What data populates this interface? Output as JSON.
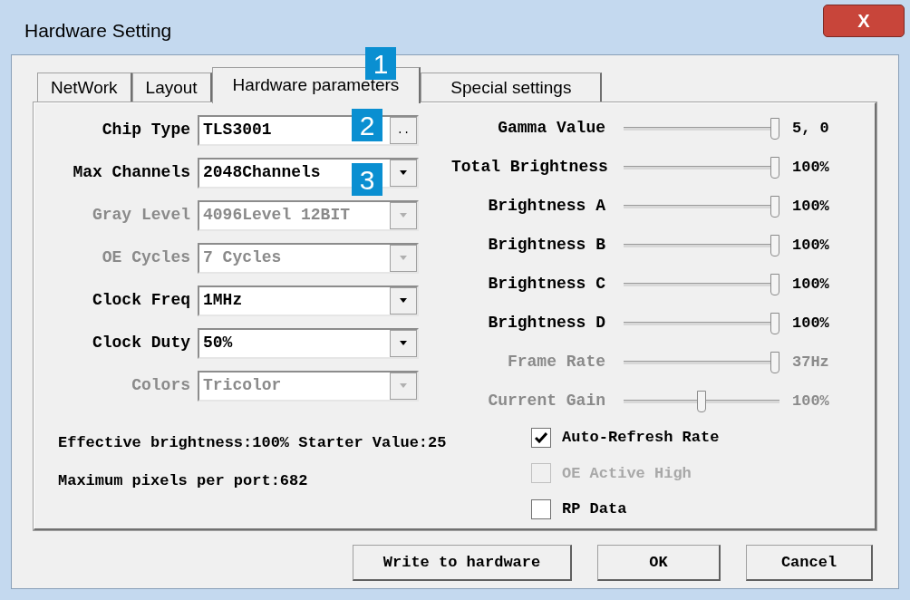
{
  "window": {
    "title": "Hardware Setting",
    "close": "X"
  },
  "tabs": [
    {
      "label": "NetWork",
      "selected": false
    },
    {
      "label": "Layout",
      "selected": false
    },
    {
      "label": "Hardware parameters",
      "selected": true
    },
    {
      "label": "Special settings",
      "selected": false
    }
  ],
  "fields": [
    {
      "label": "Chip Type",
      "kind": "text",
      "value": "TLS3001",
      "button": "..",
      "disabled": false
    },
    {
      "label": "Max Channels",
      "kind": "dropdown",
      "value": "2048Channels",
      "disabled": false
    },
    {
      "label": "Gray Level",
      "kind": "dropdown",
      "value": "4096Level 12BIT",
      "disabled": true
    },
    {
      "label": "OE Cycles",
      "kind": "dropdown",
      "value": "7 Cycles",
      "disabled": true
    },
    {
      "label": "Clock Freq",
      "kind": "dropdown",
      "value": "1MHz",
      "disabled": false
    },
    {
      "label": "Clock Duty",
      "kind": "dropdown",
      "value": "50%",
      "disabled": false
    },
    {
      "label": "Colors",
      "kind": "dropdown",
      "value": "Tricolor",
      "disabled": true
    }
  ],
  "sliders": [
    {
      "label": "Gamma Value",
      "level": 1,
      "reading": "5, 0",
      "disabled": false
    },
    {
      "label": "Total Brightness",
      "level": 1,
      "reading": "100%",
      "disabled": false
    },
    {
      "label": "Brightness A",
      "level": 1,
      "reading": "100%",
      "disabled": false
    },
    {
      "label": "Brightness B",
      "level": 1,
      "reading": "100%",
      "disabled": false
    },
    {
      "label": "Brightness C",
      "level": 1,
      "reading": "100%",
      "disabled": false
    },
    {
      "label": "Brightness D",
      "level": 1,
      "reading": "100%",
      "disabled": false
    },
    {
      "label": "Frame Rate",
      "level": 1,
      "reading": "37Hz",
      "disabled": true
    },
    {
      "label": "Current Gain",
      "level": 0.5,
      "reading": "100%",
      "disabled": true
    }
  ],
  "info": [
    "Effective brightness:100% Starter Value:25",
    "Maximum pixels per port:682"
  ],
  "checkboxes": [
    {
      "label": "Auto-Refresh Rate",
      "checked": true,
      "disabled": false
    },
    {
      "label": "OE Active High",
      "checked": false,
      "disabled": true
    },
    {
      "label": "RP Data",
      "checked": false,
      "disabled": false
    }
  ],
  "buttons": [
    "Write to hardware",
    "OK",
    "Cancel"
  ],
  "callouts": [
    "1",
    "2",
    "3"
  ]
}
